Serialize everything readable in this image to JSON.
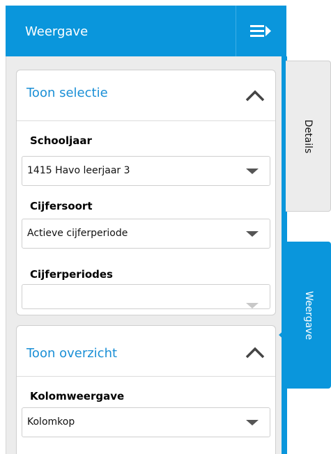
{
  "panel": {
    "title": "Weergave",
    "collapse_icon": "collapse-menu-icon",
    "accent_color": "#0a96dc"
  },
  "selection": {
    "title": "Toon selectie",
    "toggle_icon": "chevron-up-icon",
    "fields": [
      {
        "label": "Schooljaar",
        "value": "1415 Havo leerjaar 3"
      },
      {
        "label": "Cijfersoort",
        "value": "Actieve cijferperiode"
      },
      {
        "label": "Cijferperiodes",
        "value": ""
      }
    ]
  },
  "overview": {
    "title": "Toon overzicht",
    "toggle_icon": "chevron-up-icon",
    "fields": [
      {
        "label": "Kolomweergave",
        "value": "Kolomkop"
      }
    ]
  },
  "side_tabs": [
    {
      "label": "Details",
      "active": false
    },
    {
      "label": "Weergave",
      "active": true
    }
  ]
}
